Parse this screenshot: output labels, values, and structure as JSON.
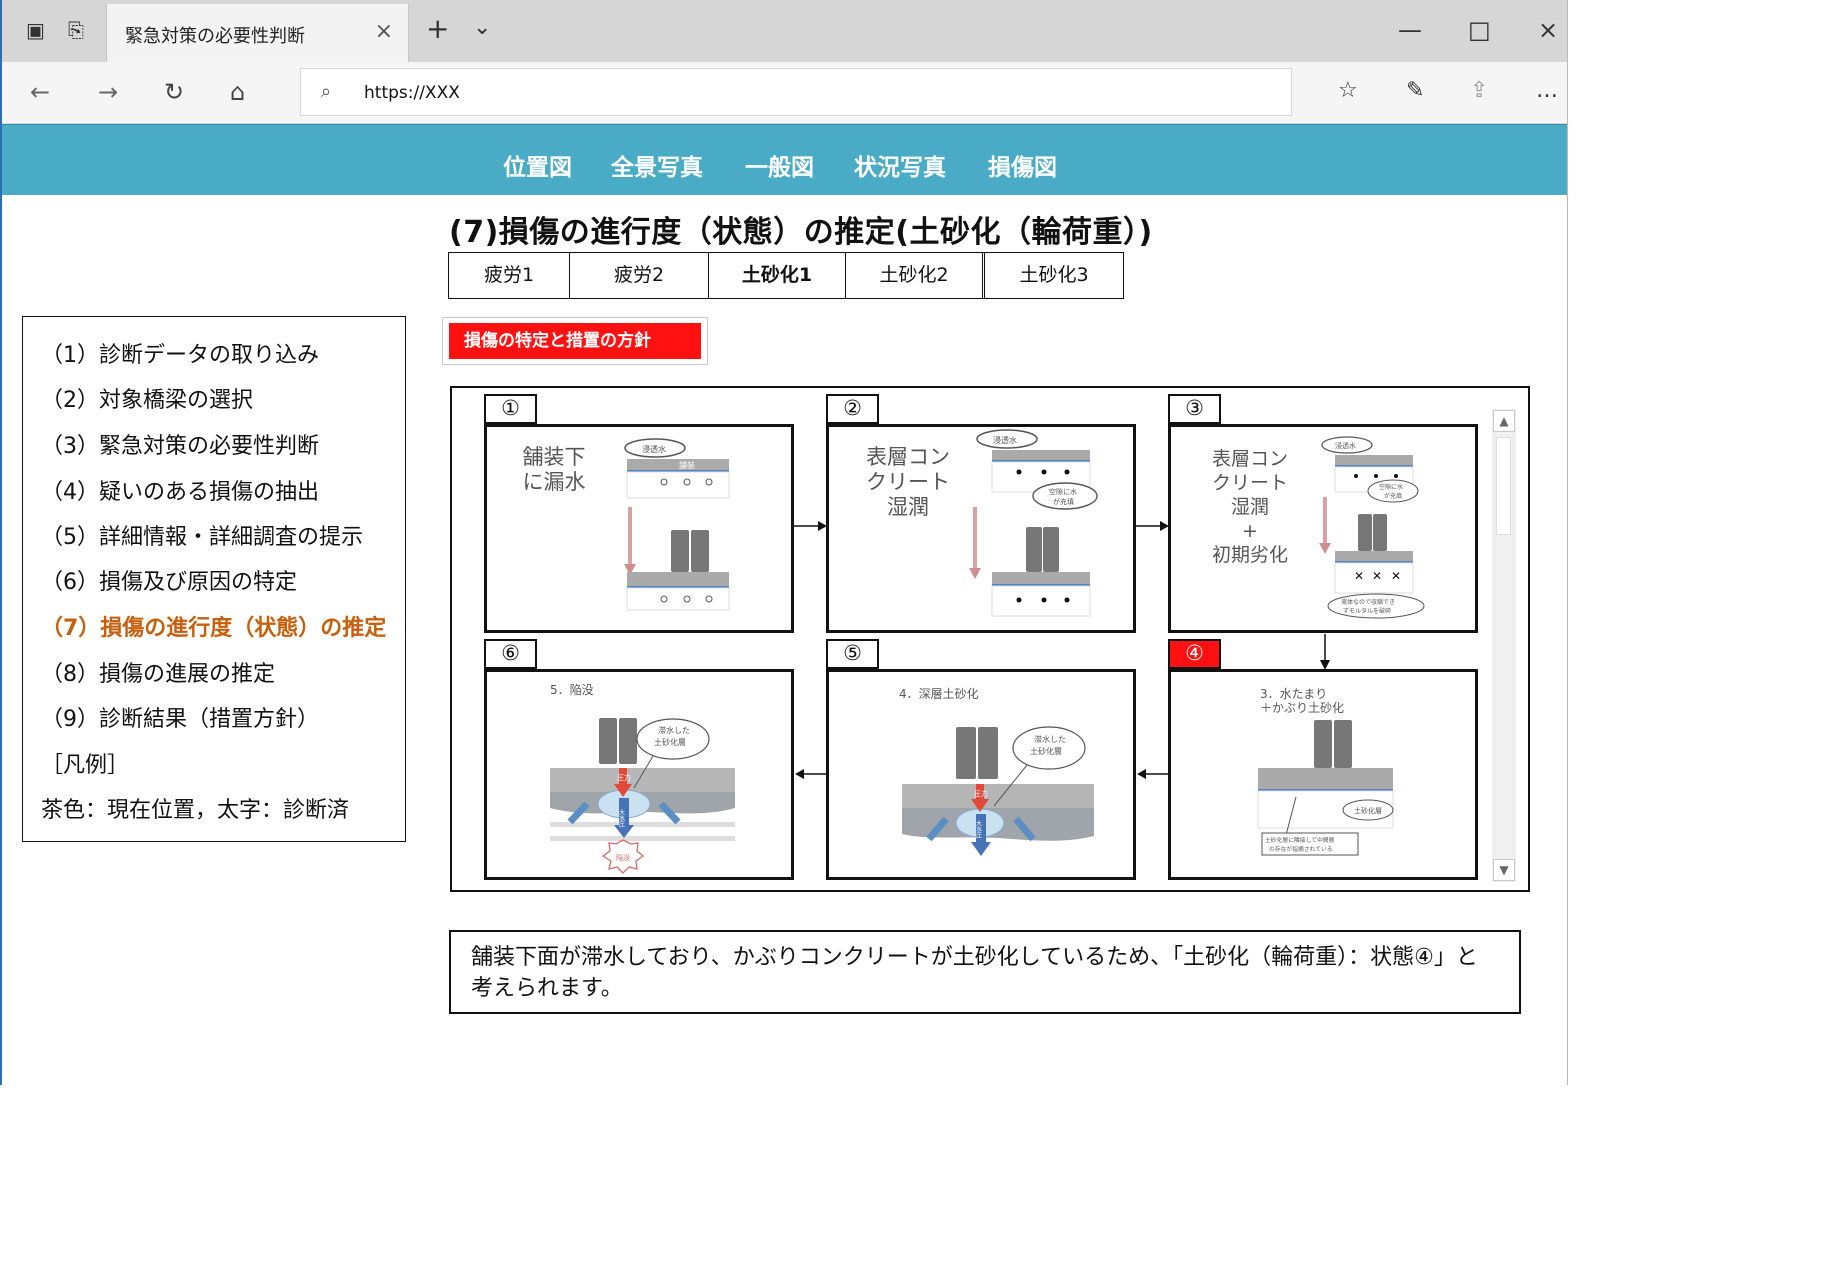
{
  "browser": {
    "tab_title": "緊急対策の必要性判断",
    "url": "https://XXX",
    "icons": {
      "tab_left_1": "window-icon",
      "tab_left_2": "tabs-icon",
      "close": "close-icon",
      "new_tab": "plus-icon",
      "tab_menu": "chevron-down-icon",
      "back": "back-arrow-icon",
      "forward": "forward-arrow-icon",
      "refresh": "refresh-icon",
      "home": "home-icon",
      "search": "search-icon",
      "favorites": "favorites-icon",
      "pen": "pen-icon",
      "share": "share-icon",
      "more": "more-icon"
    }
  },
  "top_nav": {
    "items": [
      "位置図",
      "全景写真",
      "一般図",
      "状況写真",
      "損傷図"
    ]
  },
  "page": {
    "title": "(7)損傷の進行度（状態）の推定(土砂化（輪荷重）)",
    "subtabs": [
      {
        "label": "疲労1",
        "bold": false
      },
      {
        "label": "疲労2",
        "bold": false
      },
      {
        "label": "土砂化1",
        "bold": true
      },
      {
        "label": "土砂化2",
        "bold": false
      },
      {
        "label": "土砂化3",
        "bold": false
      }
    ],
    "action_button": "損傷の特定と措置の方針",
    "message": "舗装下面が滞水しており、かぶりコンクリートが土砂化しているため、「土砂化（輪荷重）：状態④」と考えられます。"
  },
  "sidebar": {
    "items": [
      {
        "label": "（1）診断データの取り込み",
        "active": false
      },
      {
        "label": "（2）対象橋梁の選択",
        "active": false
      },
      {
        "label": "（3）緊急対策の必要性判断",
        "active": false
      },
      {
        "label": "（4）疑いのある損傷の抽出",
        "active": false
      },
      {
        "label": "（5）詳細情報・詳細調査の提示",
        "active": false
      },
      {
        "label": "（6）損傷及び原因の特定",
        "active": false
      },
      {
        "label": "（7）損傷の進行度（状態）の推定",
        "active": true
      },
      {
        "label": "（8）損傷の進展の推定",
        "active": false
      },
      {
        "label": "（9）診断結果（措置方針）",
        "active": false
      },
      {
        "label": "［凡例］",
        "active": false
      },
      {
        "label": "茶色：現在位置，太字：診断済",
        "active": false
      }
    ]
  },
  "diagram": {
    "stages": [
      {
        "num": "①",
        "title": "舗装下\nに漏水",
        "tag": "浸透水",
        "layer": "舗装"
      },
      {
        "num": "②",
        "title": "表層コン\nクリート\n湿潤",
        "tag": "浸透水",
        "note": "空隙に水\nが充填"
      },
      {
        "num": "③",
        "title": "表層コン\nクリート\n湿潤\n+\n初期劣化",
        "tag": "浸透水",
        "note": "空隙に水\nが充填",
        "caption": "液体なので収縮でき\nずモルタルを破砕"
      },
      {
        "num": "④",
        "title": "3．水たまり\n＋かぶり土砂化",
        "label": "土砂化層",
        "caption": "土砂化層に隣接して中間層\nの存在が指摘されている"
      },
      {
        "num": "⑤",
        "title": "4．深層土砂化",
        "callout": "滞水した\n土砂化層",
        "pressure": "圧力",
        "water": "大水圧"
      },
      {
        "num": "⑥",
        "title": "5．陥没",
        "callout": "滞水した\n土砂化層",
        "pressure": "圧力",
        "water": "大水圧",
        "burst": "陥没"
      }
    ],
    "active_stage": "④",
    "colors": {
      "accent_red": "#ff1111",
      "nav_blue": "#4aabc7",
      "active_text": "#c85f0c"
    }
  }
}
